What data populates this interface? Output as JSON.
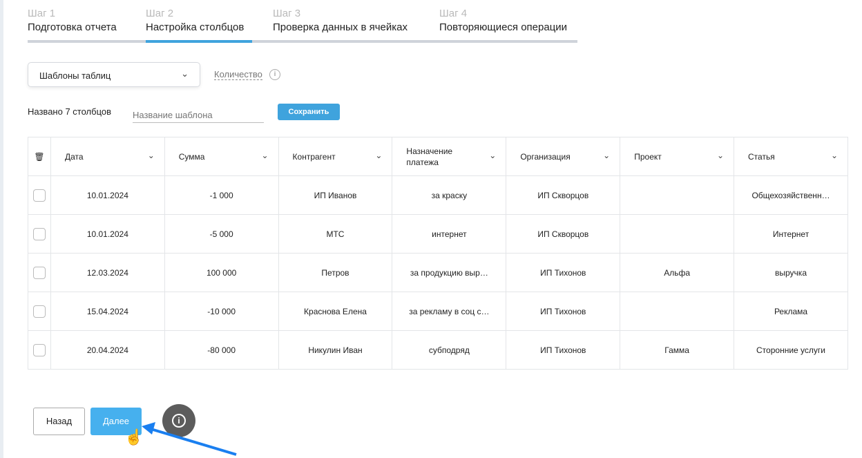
{
  "steps": [
    {
      "num": "Шаг 1",
      "title": "Подготовка отчета"
    },
    {
      "num": "Шаг 2",
      "title": "Настройка столбцов"
    },
    {
      "num": "Шаг 3",
      "title": "Проверка данных в ячейках"
    },
    {
      "num": "Шаг 4",
      "title": "Повторяющиеся операции"
    }
  ],
  "template_select": "Шаблоны таблиц",
  "quantity_label": "Количество",
  "named_columns": "Названо 7 столбцов",
  "template_name_placeholder": "Название шаблона",
  "save_label": "Сохранить",
  "columns": [
    "Дата",
    "Сумма",
    "Контрагент",
    "Назначение платежа",
    "Организация",
    "Проект",
    "Статья"
  ],
  "rows": [
    [
      "10.01.2024",
      "-1 000",
      "ИП Иванов",
      "за краску",
      "ИП Скворцов",
      "",
      "Общехозяйственн…"
    ],
    [
      "10.01.2024",
      "-5 000",
      "МТС",
      "интернет",
      "ИП Скворцов",
      "",
      "Интернет"
    ],
    [
      "12.03.2024",
      "100 000",
      "Петров",
      "за продукцию выр…",
      "ИП Тихонов",
      "Альфа",
      "выручка"
    ],
    [
      "15.04.2024",
      "-10 000",
      "Краснова Елена",
      "за рекламу в соц с…",
      "ИП Тихонов",
      "",
      "Реклама"
    ],
    [
      "20.04.2024",
      "-80 000",
      "Никулин Иван",
      "субподряд",
      "ИП Тихонов",
      "Гамма",
      "Сторонние услуги"
    ]
  ],
  "back_label": "Назад",
  "next_label": "Далее"
}
